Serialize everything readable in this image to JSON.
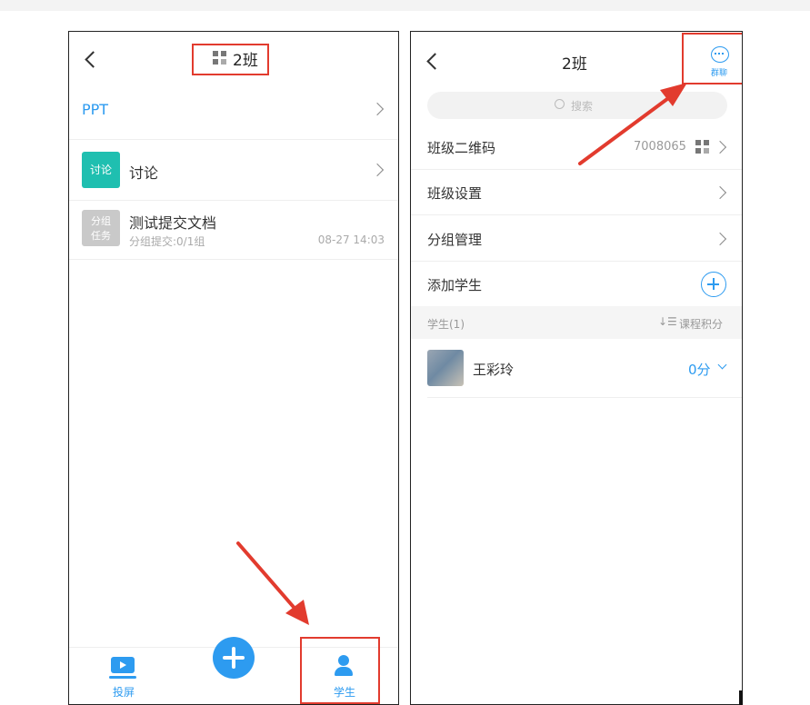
{
  "left_screen": {
    "title": "2班",
    "rows": [
      {
        "label": "PPT"
      },
      {
        "icon_text": "讨论",
        "label": "讨论"
      },
      {
        "icon_text_1": "分组",
        "icon_text_2": "任务",
        "title": "测试提交文档",
        "subtitle": "分组提交:0/1组",
        "time": "08-27 14:03"
      }
    ],
    "tabs": [
      {
        "label": "投屏",
        "icon": "screen-cast-icon"
      },
      {
        "label": "",
        "icon": "plus-icon"
      },
      {
        "label": "学生",
        "icon": "person-icon"
      }
    ]
  },
  "right_screen": {
    "title": "2班",
    "chat_label": "群聊",
    "search_placeholder": "搜索",
    "rows": {
      "qrcode_label": "班级二维码",
      "qrcode_value": "7008065",
      "settings_label": "班级设置",
      "group_label": "分组管理",
      "add_student_label": "添加学生"
    },
    "students_header": "学生(1)",
    "sort_label": "课程积分",
    "students": [
      {
        "name": "王彩玲",
        "score": "0分"
      }
    ]
  },
  "colors": {
    "accent_blue": "#2d9bf0",
    "discussion_green": "#1fbfb0",
    "highlight_red": "#e23b2e"
  }
}
